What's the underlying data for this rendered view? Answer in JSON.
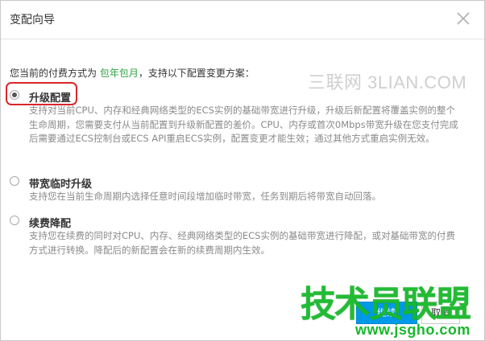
{
  "dialog": {
    "title": "变配向导",
    "close_icon": "close-icon"
  },
  "intro": {
    "prefix": "您当前的付费方式为",
    "payment_method": "包年包月",
    "suffix": "，支持以下配置变更方案："
  },
  "options": [
    {
      "label": "升级配置",
      "selected": true,
      "description": "支持对当前CPU、内存和经典网络类型的ECS实例的基础带宽进行升级，升级后新配置将覆盖实例的整个生命周期，您需要支付从当前配置到升级新配置的差价。CPU、内存或首次0Mbps带宽升级在您支付完成后需要通过ECS控制台或ECS API重启ECS实例，配置变更才能生效；通过其他方式重启实例无效。"
    },
    {
      "label": "带宽临时升级",
      "selected": false,
      "description": "支持您在当前生命周期内选择任意时间段增加临时带宽，任务到期后将带宽自动回落。"
    },
    {
      "label": "续费降配",
      "selected": false,
      "description": "支持您在续费的同时对CPU、内存、经典网络类型的ECS实例的基础带宽进行降配，或对基础带宽的付费方式进行转换。降配后的新配置会在新的续费周期内生效。"
    }
  ],
  "footer": {
    "next_label": "继续",
    "cancel_label": "取消"
  },
  "watermarks": {
    "top": "三联网 3LIAN.COM",
    "logo_main": "技术员联盟",
    "logo_url": "www.jsgho.com"
  },
  "colors": {
    "highlight_green": "#2fa342",
    "primary_blue": "#0099e8",
    "annotation_red": "#d9262c",
    "watermark_green": "#18b82b"
  }
}
